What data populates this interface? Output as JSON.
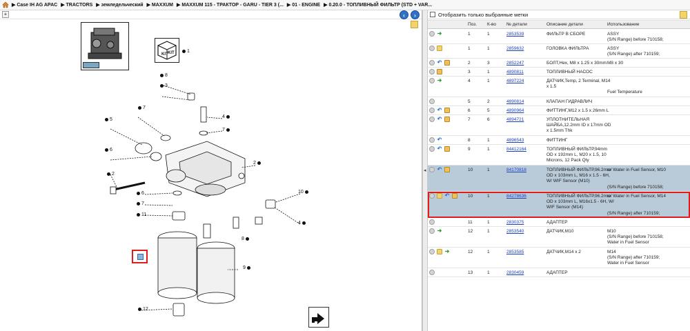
{
  "breadcrumb": [
    "Case IH AG APAC",
    "TRACTORS",
    "земледельческий",
    "MAXXUM",
    "MAXXUM 115 - ТРАКТОР - GARU - TIER 3 (...",
    "01 - ENGINE",
    "0.20.0 - ТОПЛИВНЫЙ ФИЛЬТР (STD + VAR..."
  ],
  "diagram": {
    "callouts": [
      "8",
      "3",
      "5",
      "2",
      "1",
      "6",
      "4",
      "7",
      "4",
      "8",
      "11",
      "9",
      "10",
      "12",
      "7",
      "7",
      "6",
      "2"
    ],
    "kit_labels": [
      "KIT",
      "KIT"
    ]
  },
  "filter": {
    "label": "Отобразить только выбранные метки"
  },
  "columns": [
    "Поз.",
    "К-во",
    "№ детали",
    "Описание детали",
    "Использование"
  ],
  "rows": [
    {
      "pos": "1",
      "qty": "1",
      "part": "2853539",
      "desc": [
        "ФИЛЬТР В СБОРЕ"
      ],
      "usage": [
        "ASSY",
        "(S/N Range) before 710158;"
      ],
      "icons": [
        "circle",
        "arrow"
      ],
      "sel": false,
      "hl": false
    },
    {
      "pos": "1",
      "qty": "1",
      "part": "2859632",
      "desc": [
        "ГОЛОВКА ФИЛЬТРА"
      ],
      "usage": [
        "ASSY",
        "(S/N Range) after 710159;"
      ],
      "icons": [
        "circle",
        "note"
      ],
      "sel": false,
      "hl": false
    },
    {
      "pos": "2",
      "qty": "3",
      "part": "2852247",
      "desc": [
        "БОЛТ,Hex, M8 x 1.25 x 30mm"
      ],
      "usage": [
        "M8 x 30"
      ],
      "icons": [
        "circle",
        "undo",
        "box"
      ],
      "sel": false,
      "hl": false
    },
    {
      "pos": "3",
      "qty": "1",
      "part": "4890811",
      "desc": [
        "ТОПЛИВНЫЙ НАСОС"
      ],
      "usage": [],
      "icons": [
        "circle",
        "box"
      ],
      "sel": false,
      "hl": false
    },
    {
      "pos": "4",
      "qty": "1",
      "part": "4897224",
      "desc": [
        "ДАТЧИК,Temp, 2 Terminal, M14",
        "x 1.5"
      ],
      "usage": [
        "",
        "",
        "Fuel Temperature"
      ],
      "icons": [
        "circle",
        "arrow"
      ],
      "sel": false,
      "hl": false
    },
    {
      "pos": "5",
      "qty": "2",
      "part": "4890814",
      "desc": [
        "КЛАПАН ГИДРАВЛИЧ"
      ],
      "usage": [],
      "icons": [
        "circle"
      ],
      "sel": false,
      "hl": false
    },
    {
      "pos": "6",
      "qty": "5",
      "part": "4890964",
      "desc": [
        "ФИТТИНГ,M12 x 1.5 x 26mm L"
      ],
      "usage": [],
      "icons": [
        "circle",
        "undo",
        "box"
      ],
      "sel": false,
      "hl": false
    },
    {
      "pos": "7",
      "qty": "6",
      "part": "4894721",
      "desc": [
        "УПЛОТНИТЕЛЬНАЯ",
        "ШАЙБА,12.2mm ID x 17mm OD",
        "x 1.5mm Thk"
      ],
      "usage": [],
      "icons": [
        "circle",
        "undo",
        "box"
      ],
      "sel": false,
      "hl": false
    },
    {
      "pos": "8",
      "qty": "1",
      "part": "4896543",
      "desc": [
        "ФИТТИНГ"
      ],
      "usage": [],
      "icons": [
        "circle",
        "undo"
      ],
      "sel": false,
      "hl": false
    },
    {
      "pos": "9",
      "qty": "1",
      "part": "84412164",
      "desc": [
        "ТОПЛИВНЫЙ ФИЛЬТР,94mm",
        "OD x 192mm L, M20 x 1.5, 10",
        "Microns, 12 Pack Qty"
      ],
      "usage": [],
      "icons": [
        "circle",
        "undo",
        "box"
      ],
      "sel": false,
      "hl": false
    },
    {
      "pos": "10",
      "qty": "1",
      "part": "84170818",
      "desc": [
        "ТОПЛИВНЫЙ ФИЛЬТР,96.2mm",
        "OD x 103mm L, M16 x 1.5 - 6H,",
        "W/ WIF Sensor (M10)"
      ],
      "usage": [
        "w/ Water in Fuel Sensor, M10",
        "",
        "",
        "(S/N Range) before 710158;"
      ],
      "icons": [
        "circle",
        "undo",
        "box"
      ],
      "sel": true,
      "hl": false
    },
    {
      "pos": "10",
      "qty": "1",
      "part": "84278636",
      "desc": [
        "ТОПЛИВНЫЙ ФИЛЬТР,96.2mm",
        "OD x 103mm L, M16x1.5 - 6H, W/",
        "WIF Sensor (M14)"
      ],
      "usage": [
        "w/ Water in Fuel Sensor, M14",
        "",
        "",
        "(S/N Range) after 710159;"
      ],
      "icons": [
        "circle",
        "note",
        "undo",
        "box"
      ],
      "sel": true,
      "hl": true
    },
    {
      "pos": "11",
      "qty": "1",
      "part": "2830375",
      "desc": [
        "АДАПТЕР"
      ],
      "usage": [],
      "icons": [
        "circle"
      ],
      "sel": false,
      "hl": false
    },
    {
      "pos": "12",
      "qty": "1",
      "part": "2853540",
      "desc": [
        "ДАТЧИК,M10"
      ],
      "usage": [
        "M10",
        "(S/N Range) before 710158;",
        "Water in Fuel Sensor"
      ],
      "icons": [
        "circle",
        "arrow"
      ],
      "sel": false,
      "hl": false
    },
    {
      "pos": "12",
      "qty": "1",
      "part": "2853585",
      "desc": [
        "ДАТЧИК,M14 x 2"
      ],
      "usage": [
        "M14",
        "(S/N Range) after 710159;",
        "Water in Fuel Sensor"
      ],
      "icons": [
        "circle",
        "note",
        "arrow"
      ],
      "sel": false,
      "hl": false
    },
    {
      "pos": "13",
      "qty": "1",
      "part": "2830459",
      "desc": [
        "АДАПТЕР"
      ],
      "usage": [],
      "icons": [
        "circle"
      ],
      "sel": false,
      "hl": false
    }
  ]
}
